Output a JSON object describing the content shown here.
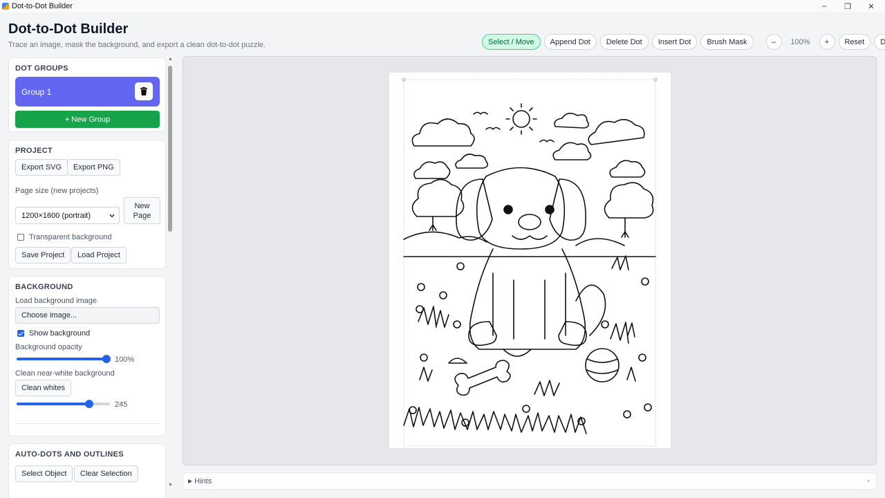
{
  "window": {
    "title": "Dot-to-Dot Builder",
    "minimize": "–",
    "maximize": "❐",
    "close": "✕"
  },
  "header": {
    "title": "Dot-to-Dot Builder",
    "subtitle": "Trace an image, mask the background, and export a clean dot-to-dot puzzle."
  },
  "toolbar": {
    "select_move": "Select / Move",
    "append_dot": "Append Dot",
    "delete_dot": "Delete Dot",
    "insert_dot": "Insert Dot",
    "brush_mask": "Brush Mask",
    "zoom_out": "–",
    "zoom_level": "100%",
    "zoom_in": "+",
    "reset": "Reset",
    "theme": "Dark"
  },
  "dot_groups": {
    "heading": "DOT GROUPS",
    "groups": [
      {
        "name": "Group 1"
      }
    ],
    "new_group": "+ New Group"
  },
  "project": {
    "heading": "PROJECT",
    "export_svg": "Export SVG",
    "export_png": "Export PNG",
    "page_size_label": "Page size (new projects)",
    "page_size_value": "1200×1600 (portrait)",
    "new_page_line1": "New",
    "new_page_line2": "Page",
    "transparent_label": "Transparent background",
    "transparent_checked": false,
    "save_project": "Save Project",
    "load_project": "Load Project"
  },
  "background": {
    "heading": "BACKGROUND",
    "load_label": "Load background image",
    "choose_image": "Choose image...",
    "show_label": "Show background",
    "show_checked": true,
    "opacity_label": "Background opacity",
    "opacity_value": "100%",
    "opacity_fraction": 1.0,
    "clean_label": "Clean near-white background",
    "clean_button": "Clean whites",
    "threshold_value": "245",
    "threshold_fraction": 0.78
  },
  "auto_dots": {
    "heading": "AUTO-DOTS AND OUTLINES",
    "select_object": "Select Object",
    "clear_selection": "Clear Selection"
  },
  "hints": {
    "label": "Hints"
  },
  "colors": {
    "accent_group": "#6366f1",
    "new_group": "#16a34a",
    "active_tool": "#d1fae5",
    "slider": "#2563eb"
  },
  "canvas": {
    "image_description_icon": "puppy-coloring-page"
  }
}
